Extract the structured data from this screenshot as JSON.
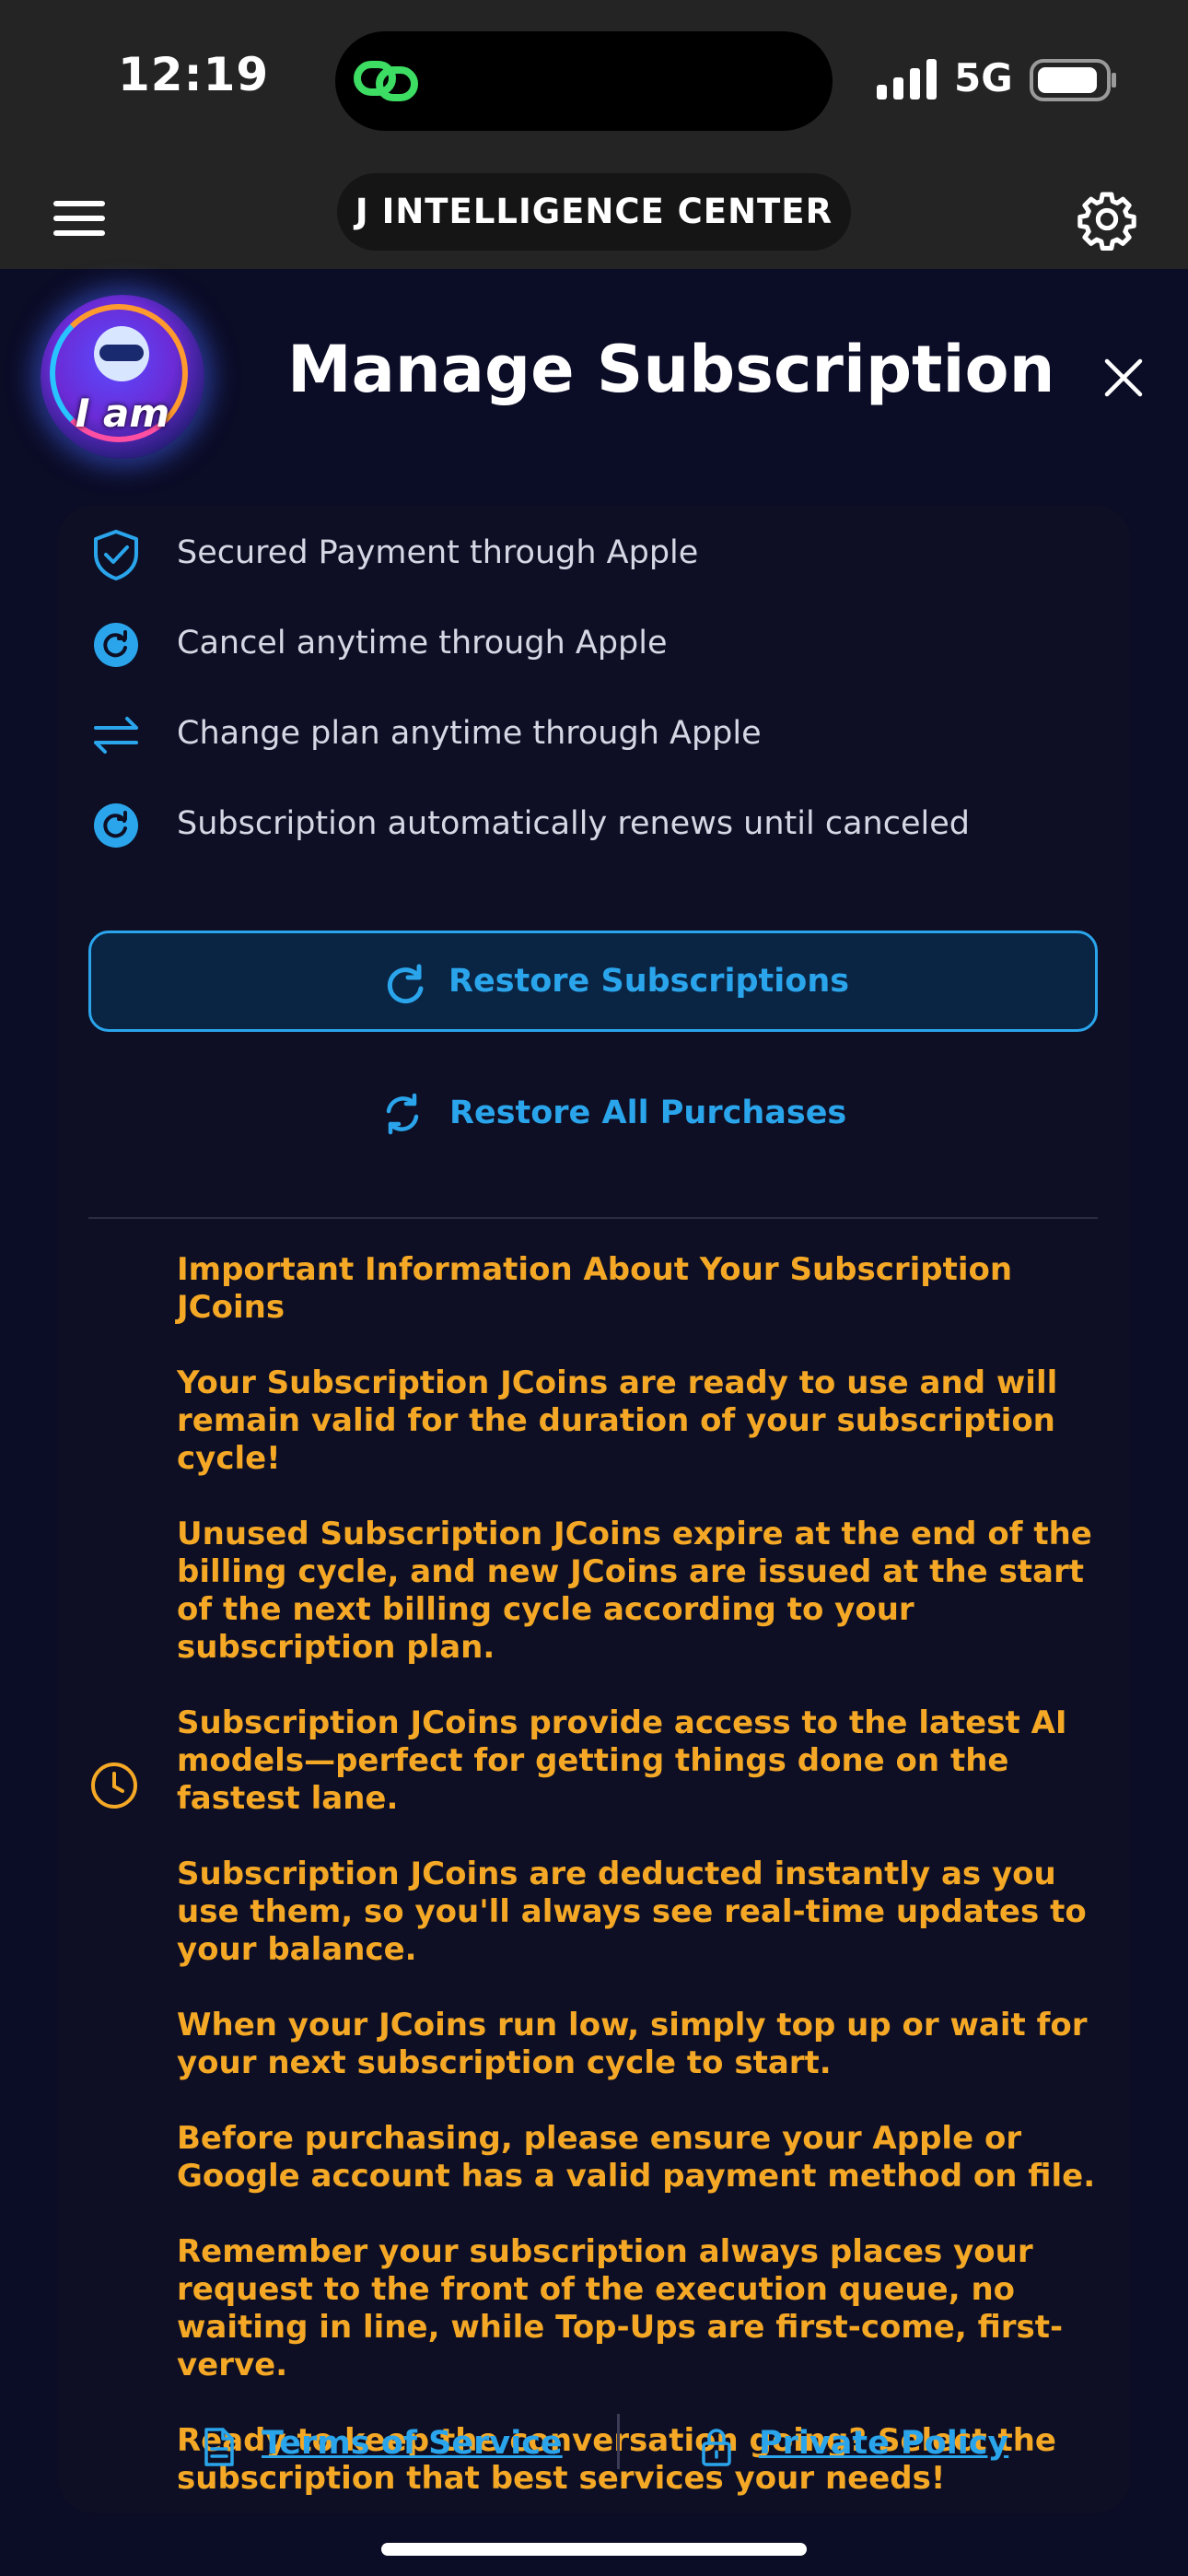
{
  "status_bar": {
    "time": "12:19",
    "network": "5G",
    "island_app_icon": "link-icon",
    "colors": {
      "island_icon": "#3ddc63"
    }
  },
  "nav": {
    "menu_icon": "hamburger-menu-icon",
    "title": "J INTELLIGENCE CENTER",
    "settings_icon": "gear-icon"
  },
  "header": {
    "logo_text": "I am",
    "title": "Manage Subscription",
    "close_icon": "close-icon"
  },
  "features": [
    {
      "icon": "shield-check-icon",
      "label": "Secured Payment through Apple"
    },
    {
      "icon": "cancel-refresh-icon",
      "label": "Cancel anytime through Apple"
    },
    {
      "icon": "swap-arrows-icon",
      "label": "Change plan anytime through Apple"
    },
    {
      "icon": "auto-renew-icon",
      "label": "Subscription automatically renews until canceled"
    }
  ],
  "actions": {
    "restore_subscriptions": "Restore Subscriptions",
    "restore_all_purchases": "Restore All Purchases"
  },
  "info": {
    "icon": "clock-icon",
    "paragraphs": [
      "Important Information About Your Subscription JCoins",
      "Your Subscription JCoins are ready to use and will remain valid for the duration of your subscription cycle!",
      "Unused Subscription JCoins expire at the end of the billing cycle, and new JCoins are issued at the start of the next billing cycle according to your subscription plan.",
      "Subscription JCoins provide access to the latest AI models—perfect for getting things done on the fastest lane.",
      "Subscription JCoins are deducted instantly as you use them, so you'll always see real-time updates to your balance.",
      "When your JCoins run low, simply top up or wait for your next subscription cycle to start.",
      "Before purchasing, please ensure your Apple or Google account has a valid payment method on file.",
      "Remember your subscription always places your request to the front of the execution queue, no waiting in line, while Top-Ups are first-come, first-verve.",
      "Ready to keep the conversation going? Select the subscription that best services your needs!"
    ]
  },
  "footer": {
    "terms": "Terms of Service",
    "privacy": "Private Policy"
  },
  "colors": {
    "background": "#0b0c26",
    "accent_blue": "#2aa5ec",
    "info_orange": "#f4a825"
  }
}
